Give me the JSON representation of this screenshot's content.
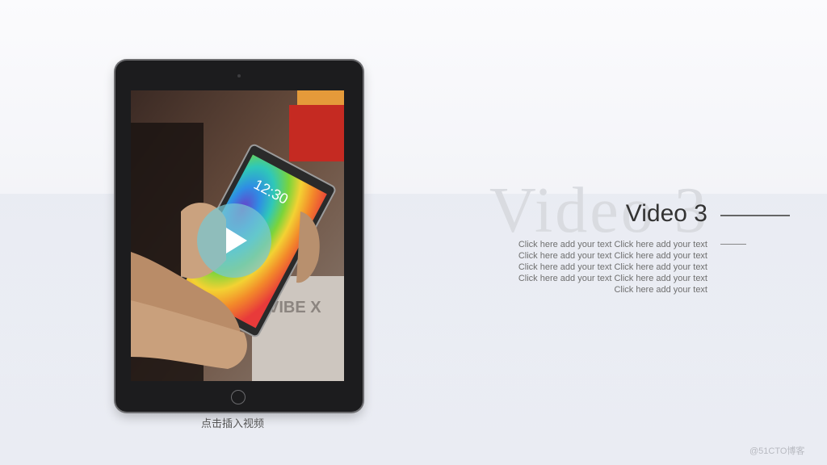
{
  "slide": {
    "ghost_title": "Video 3",
    "title": "Video 3",
    "body_text": "Click here add your text Click here add your text Click here add your text Click here add your text Click here add your text Click here add your text Click here add your text Click here add your text Click here add your text",
    "caption": "点击插入视频",
    "watermark": "@51CTO博客"
  },
  "video": {
    "phone_time": "12:30",
    "brand_text": "VIBE X"
  },
  "icons": {
    "play": "play-icon"
  },
  "colors": {
    "title": "#333333",
    "body_text": "#6f6f6f",
    "tablet_bezel": "#1c1c1e",
    "play_overlay": "#78c8d2"
  }
}
